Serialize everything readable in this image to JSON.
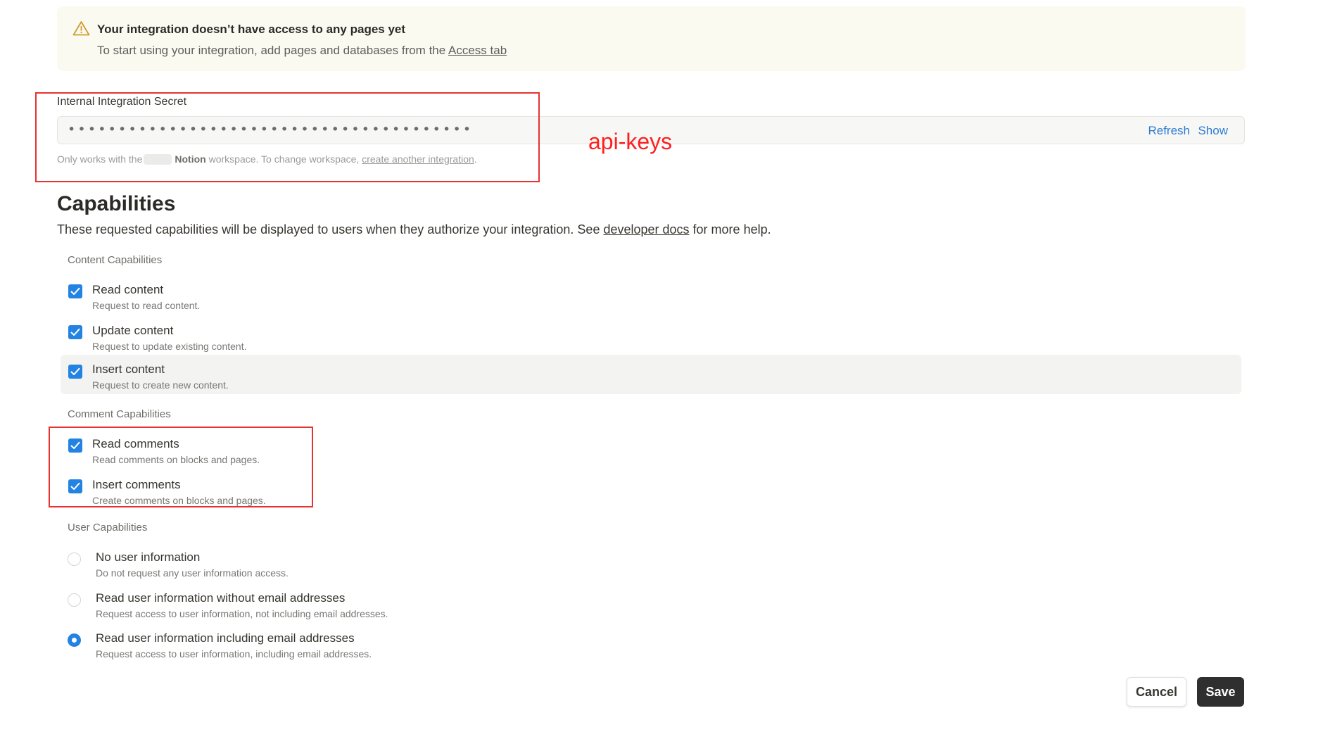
{
  "banner": {
    "title": "Your integration doesn’t have access to any pages yet",
    "text_prefix": "To start using your integration, add pages and databases from the ",
    "link": "Access tab"
  },
  "secret": {
    "label": "Internal Integration Secret",
    "masked_value": "••••••••••••••••••••••••••••••••••••••••",
    "refresh_label": "Refresh",
    "show_label": "Show",
    "note_prefix": "Only works with the",
    "workspace": "Notion",
    "note_middle": "workspace. To change workspace,",
    "note_link": "create another integration",
    "note_suffix": "."
  },
  "annotation": {
    "label": "api-keys",
    "color": "#ff1f1f"
  },
  "capabilities": {
    "title": "Capabilities",
    "desc_prefix": "These requested capabilities will be displayed to users when they authorize your integration. See ",
    "desc_link": "developer docs",
    "desc_suffix": " for more help.",
    "groups": {
      "content": {
        "label": "Content Capabilities",
        "items": [
          {
            "title": "Read content",
            "sub": "Request to read content.",
            "checked": true
          },
          {
            "title": "Update content",
            "sub": "Request to update existing content.",
            "checked": true
          },
          {
            "title": "Insert content",
            "sub": "Request to create new content.",
            "checked": true
          }
        ]
      },
      "comment": {
        "label": "Comment Capabilities",
        "items": [
          {
            "title": "Read comments",
            "sub": "Read comments on blocks and pages.",
            "checked": true
          },
          {
            "title": "Insert comments",
            "sub": "Create comments on blocks and pages.",
            "checked": true
          }
        ]
      },
      "user": {
        "label": "User Capabilities",
        "items": [
          {
            "title": "No user information",
            "sub": "Do not request any user information access.",
            "selected": false
          },
          {
            "title": "Read user information without email addresses",
            "sub": "Request access to user information, not including email addresses.",
            "selected": false
          },
          {
            "title": "Read user information including email addresses",
            "sub": "Request access to user information, including email addresses.",
            "selected": true
          }
        ]
      }
    }
  },
  "footer": {
    "cancel_label": "Cancel",
    "save_label": "Save"
  },
  "colors": {
    "accent": "#2383e2",
    "link": "#2d7bd3",
    "banner_bg": "#fbfaf1",
    "save_bg": "#2f2f2f"
  }
}
